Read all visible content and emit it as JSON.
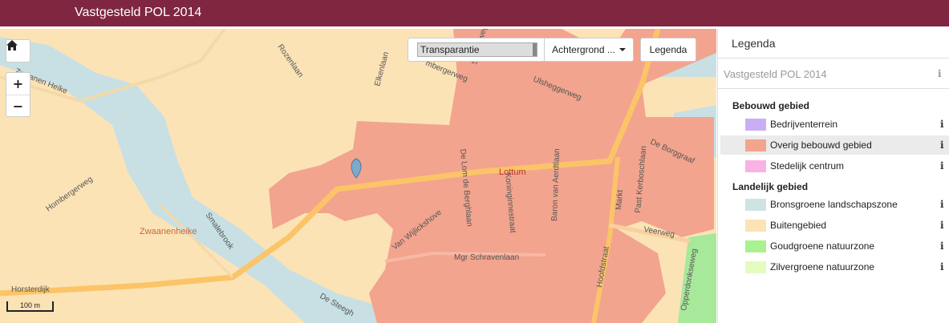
{
  "app_title": "Vastgesteld POL 2014",
  "map": {
    "controls": {
      "home_icon": "home-icon",
      "zoom_in": "+",
      "zoom_out": "−"
    },
    "toolbar": {
      "transparency_label": "Transparantie",
      "background_label": "Achtergrond ...",
      "legend_button": "Legenda"
    },
    "scale_label": "100 m",
    "labels": {
      "lottum": "Lottum",
      "zwaanenheike": "Zwaanenheike",
      "horsterdijk": "Horsterdijk",
      "hombergerweg": "Hombergerweg",
      "smalebrook": "Smalebrook",
      "de_steegh": "De Steegh",
      "rozenlaan": "Rozenlaan",
      "elkenlaan": "Elkenlaan",
      "zwaanen_heike_road": "Zwaanen Heike",
      "ombergerweg": "mbergerweg",
      "stokterweg": "Stokterweg",
      "ulsheggerweg": "Ulsheggerweg",
      "de_lom_de_berghlaan": "De Lom de Berghlaan",
      "koninginnestraat": "Koninginnestraat",
      "baron_van_aerdtlaan": "Baron van Aerdtlaan",
      "markt": "Markt",
      "past_kerboschlaan": "Past Kerboschlaan",
      "de_borggraaf": "De Borggraaf",
      "van_wijlickshove": "Van Wijlickshove",
      "mgr_schravenlaan": "Mgr Schravenlaan",
      "hoofdstraat": "Hoofdstraat",
      "veerweg": "Veerweg",
      "opperdonkseweg": "Opperdonkseweg"
    },
    "colors": {
      "base": "#fce3b6",
      "built": "#f2a48e",
      "water": "#c8e0e4",
      "green": "#a8e89a",
      "road": "#fbc468"
    }
  },
  "legend": {
    "header": "Legenda",
    "layer_name": "Vastgesteld POL 2014",
    "groups": [
      {
        "title": "Bebouwd gebied",
        "items": [
          {
            "label": "Bedrijventerrein",
            "color": "#caaef5"
          },
          {
            "label": "Overig bebouwd gebied",
            "color": "#f2a48e"
          },
          {
            "label": "Stedelijk centrum",
            "color": "#f9b2e5"
          }
        ]
      },
      {
        "title": "Landelijk gebied",
        "items": [
          {
            "label": "Bronsgroene landschapszone",
            "color": "#cde4e2"
          },
          {
            "label": "Buitengebied",
            "color": "#fce3b6"
          },
          {
            "label": "Goudgroene natuurzone",
            "color": "#a8f28f"
          },
          {
            "label": "Zilvergroene natuurzone",
            "color": "#e4fcc0"
          }
        ]
      }
    ],
    "info_icon": "info-icon"
  }
}
